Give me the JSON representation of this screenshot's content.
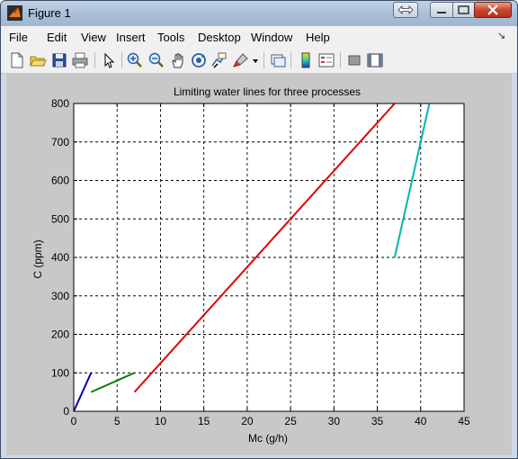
{
  "window": {
    "title": "Figure 1"
  },
  "menus": [
    "File",
    "Edit",
    "View",
    "Insert",
    "Tools",
    "Desktop",
    "Window",
    "Help"
  ],
  "toolbar": {
    "icons": [
      "new-figure-icon",
      "open-file-icon",
      "save-icon",
      "print-icon",
      "select-arrow-icon",
      "zoom-in-icon",
      "zoom-out-icon",
      "pan-hand-icon",
      "rotate-3d-icon",
      "data-cursor-icon",
      "brush-icon",
      "brush-dropdown-icon",
      "link-plot-icon",
      "colorbar-icon",
      "legend-icon",
      "hide-plot-tools-icon",
      "show-plot-tools-icon"
    ]
  },
  "colors": {
    "figure_background": "#c8c8c8",
    "axes_background": "#ffffff"
  },
  "chart_data": {
    "type": "line",
    "title": "Limiting water lines for three processes",
    "xlabel": "Mc (g/h)",
    "ylabel": "C (ppm)",
    "xlim": [
      0,
      45
    ],
    "ylim": [
      0,
      800
    ],
    "xticks": [
      0,
      5,
      10,
      15,
      20,
      25,
      30,
      35,
      40,
      45
    ],
    "yticks": [
      0,
      100,
      200,
      300,
      400,
      500,
      600,
      700,
      800
    ],
    "grid": true,
    "legend": "none",
    "series": [
      {
        "color": "#0000b0",
        "x": [
          0,
          2
        ],
        "y": [
          0,
          100
        ]
      },
      {
        "color": "#008000",
        "x": [
          2,
          7
        ],
        "y": [
          50,
          100
        ]
      },
      {
        "color": "#e00000",
        "x": [
          7,
          37
        ],
        "y": [
          50,
          800
        ]
      },
      {
        "color": "#00b4b4",
        "x": [
          37,
          41
        ],
        "y": [
          400,
          800
        ]
      }
    ]
  }
}
